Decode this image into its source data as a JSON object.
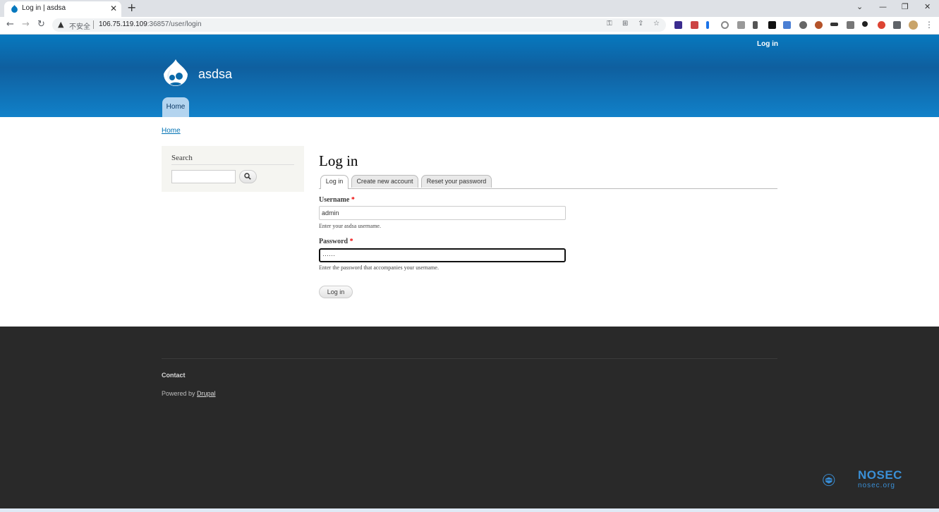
{
  "browser": {
    "tab_title": "Log in | asdsa",
    "tab_close": "✕",
    "new_tab": "+",
    "insecure_label": "不安全",
    "url_host": "106.75.119.109",
    "url_rest": ":36857/user/login",
    "window_controls": [
      "⌄",
      "—",
      "❐",
      "✕"
    ]
  },
  "header": {
    "login_link": "Log in",
    "site_name": "asdsa",
    "menu": [
      {
        "label": "Home"
      }
    ]
  },
  "breadcrumb": "Home",
  "search_block": {
    "title": "Search",
    "input_value": ""
  },
  "page": {
    "title": "Log in",
    "tabs": [
      {
        "label": "Log in",
        "active": true
      },
      {
        "label": "Create new account",
        "active": false
      },
      {
        "label": "Reset your password",
        "active": false
      }
    ],
    "username": {
      "label": "Username",
      "required_mark": "*",
      "value": "admin",
      "description": "Enter your asdsa username."
    },
    "password": {
      "label": "Password",
      "required_mark": "*",
      "value": "······",
      "description": "Enter the password that accompanies your username."
    },
    "submit_label": "Log in"
  },
  "footer": {
    "contact": "Contact",
    "powered_prefix": "Powered by ",
    "powered_link": "Drupal"
  },
  "watermark": {
    "name": "NOSEC",
    "site": "nosec.org"
  },
  "colors": {
    "header_blue": "#0779bf",
    "link_blue": "#0071b3",
    "footer_dark": "#292929",
    "required_red": "#e00000"
  }
}
